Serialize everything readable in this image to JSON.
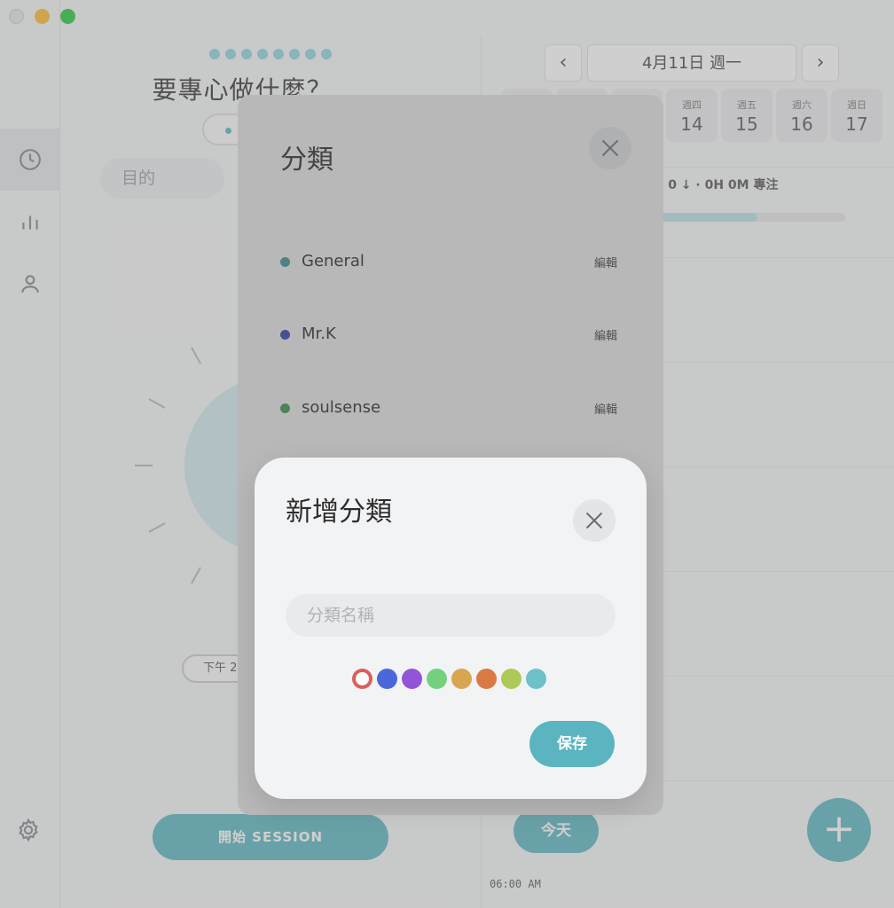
{
  "background": {
    "focus_title": "要專心做什麼？",
    "purpose_placeholder": "目的",
    "time_pill": "下午 2",
    "start_button": "開始 SESSION",
    "date": "4月11日 週一",
    "prev_icon": "chevron-left-icon",
    "next_icon": "chevron-right-icon",
    "week": [
      {
        "weekday": "週四",
        "day": "14"
      },
      {
        "weekday": "週五",
        "day": "15"
      },
      {
        "weekday": "週六",
        "day": "16"
      },
      {
        "weekday": "週日",
        "day": "17"
      }
    ],
    "stat_line": "· 0 ↓ · 0H 0M 專注",
    "today_button": "今天",
    "time_axis_label": "06:00 AM",
    "fab_label": "+",
    "sidebar_icons": [
      "clock-icon",
      "bar-chart-icon",
      "user-icon",
      "gear-icon"
    ]
  },
  "category_modal": {
    "title": "分類",
    "categories": [
      {
        "name": "General",
        "color": "#3e9a9b",
        "edit": "編輯"
      },
      {
        "name": "Mr.K",
        "color": "#2f45b3",
        "edit": "編輯"
      },
      {
        "name": "soulsense",
        "color": "#3f9c4a",
        "edit": "編輯"
      }
    ]
  },
  "add_modal": {
    "title": "新增分類",
    "name_placeholder": "分類名稱",
    "save_button": "保存",
    "colors": [
      "#d9605b",
      "#4a68d9",
      "#9254d9",
      "#73d17d",
      "#d9a650",
      "#d97a45",
      "#adc957",
      "#6ec1cb"
    ],
    "selected_color_index": 0
  }
}
